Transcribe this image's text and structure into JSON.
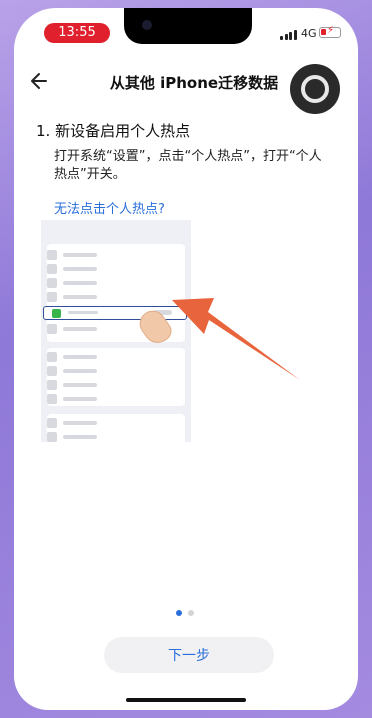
{
  "status": {
    "time": "13:55",
    "network": "4G",
    "battery_percent": 20
  },
  "nav": {
    "title": "从其他 iPhone迁移数据",
    "back_icon": "back-arrow-icon"
  },
  "step": {
    "title": "1. 新设备启用个人热点",
    "description": "打开系统“设置”，点击“个人热点”，打开“个人热点”开关。",
    "help_link": "无法点击个人热点?"
  },
  "pager": {
    "pages": 2,
    "current": 1
  },
  "actions": {
    "next_label": "下一步"
  },
  "colors": {
    "accent": "#2a6fdb",
    "arrow": "#e8643c",
    "time_pill": "#e0202c",
    "hotspot_icon": "#38b54a"
  }
}
